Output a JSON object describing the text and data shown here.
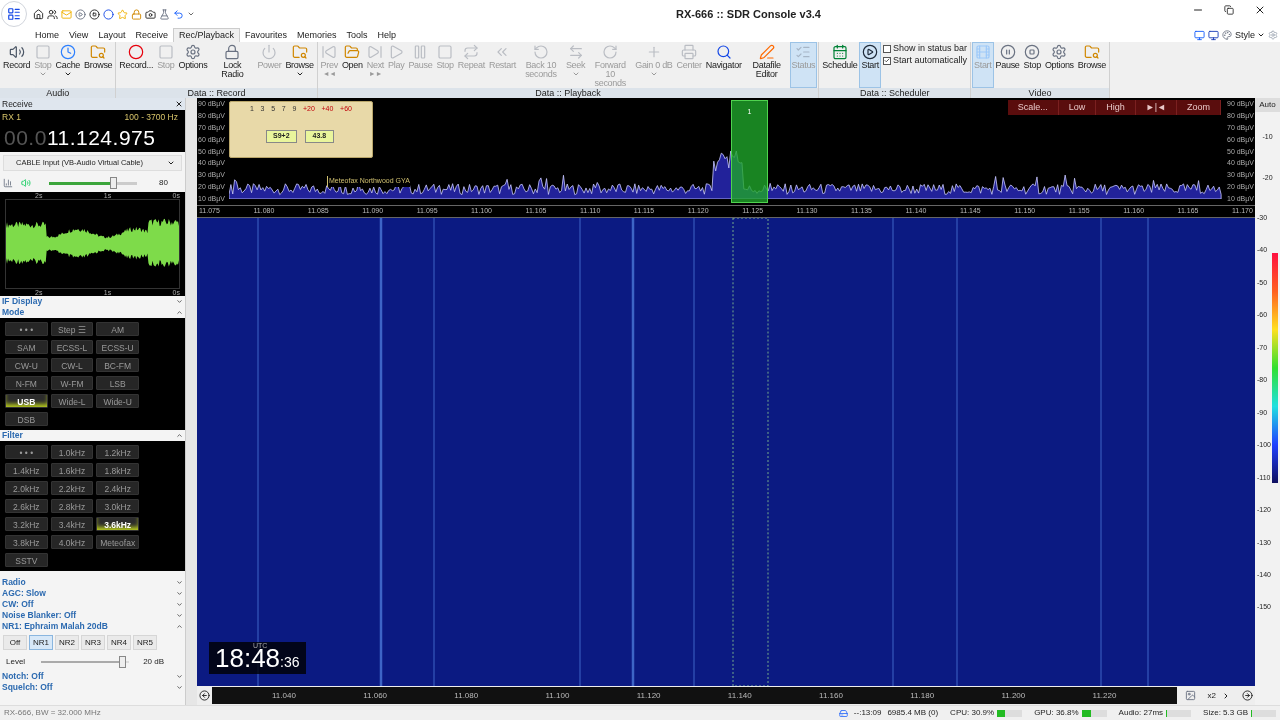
{
  "window": {
    "title": "RX-666 :: SDR Console v3.4",
    "style_menu": "Style"
  },
  "menu_tabs": [
    {
      "label": "Home",
      "selected": false
    },
    {
      "label": "View",
      "selected": false
    },
    {
      "label": "Layout",
      "selected": false
    },
    {
      "label": "Receive",
      "selected": false
    },
    {
      "label": "Rec/Playback",
      "selected": true
    },
    {
      "label": "Favourites",
      "selected": false
    },
    {
      "label": "Memories",
      "selected": false
    },
    {
      "label": "Tools",
      "selected": false
    },
    {
      "label": "Help",
      "selected": false
    }
  ],
  "ribbon": [
    {
      "name": "Audio",
      "buttons": [
        {
          "label": "Record",
          "disabled": false,
          "pressed": false,
          "caret": false
        },
        {
          "label": "Stop",
          "disabled": true,
          "pressed": false,
          "caret": true
        },
        {
          "label": "Cache",
          "disabled": false,
          "pressed": false,
          "caret": true
        },
        {
          "label": "Browse",
          "disabled": false,
          "pressed": false,
          "caret": false
        }
      ]
    },
    {
      "name": "Data :: Record",
      "buttons": [
        {
          "label": "Record...",
          "disabled": false,
          "pressed": false,
          "caret": false
        },
        {
          "label": "Stop",
          "disabled": true,
          "pressed": false,
          "caret": false
        },
        {
          "label": "Options",
          "disabled": false,
          "pressed": false,
          "caret": false
        },
        {
          "label": "Lock Radio",
          "disabled": false,
          "pressed": false,
          "caret": false
        },
        {
          "label": "Power",
          "disabled": true,
          "pressed": false,
          "caret": false
        },
        {
          "label": "Browse",
          "disabled": false,
          "pressed": false,
          "caret": true
        }
      ]
    },
    {
      "name": "Data :: Playback",
      "buttons": [
        {
          "label": "Prev",
          "sub": "◄◄",
          "disabled": true,
          "pressed": false,
          "caret": false
        },
        {
          "label": "Open",
          "disabled": false,
          "pressed": false,
          "caret": false
        },
        {
          "label": "Next",
          "sub": "►►",
          "disabled": true,
          "pressed": false,
          "caret": false
        },
        {
          "label": "Play",
          "disabled": true,
          "pressed": false,
          "caret": false
        },
        {
          "label": "Pause",
          "disabled": true,
          "pressed": false,
          "caret": false
        },
        {
          "label": "Stop",
          "disabled": true,
          "pressed": false,
          "caret": false
        },
        {
          "label": "Repeat",
          "disabled": true,
          "pressed": false,
          "caret": false
        },
        {
          "label": "Restart",
          "disabled": true,
          "pressed": false,
          "caret": false
        },
        {
          "label": "Back 10 seconds",
          "disabled": true,
          "pressed": false,
          "caret": false
        },
        {
          "label": "Seek",
          "disabled": true,
          "pressed": false,
          "caret": true
        },
        {
          "label": "Forward 10 seconds",
          "disabled": true,
          "pressed": false,
          "caret": false
        },
        {
          "label": "Gain 0 dB",
          "disabled": true,
          "pressed": false,
          "caret": true
        },
        {
          "label": "Center",
          "disabled": true,
          "pressed": false,
          "caret": false
        },
        {
          "label": "Navigator",
          "disabled": false,
          "pressed": false,
          "caret": false
        },
        {
          "label": "Datafile Editor",
          "disabled": false,
          "pressed": false,
          "caret": false
        },
        {
          "label": "Status",
          "disabled": true,
          "pressed": true,
          "caret": false
        }
      ]
    },
    {
      "name": "Data :: Scheduler",
      "buttons": [
        {
          "label": "Schedule",
          "disabled": false,
          "pressed": false,
          "caret": false
        },
        {
          "label": "Start",
          "disabled": false,
          "pressed": true,
          "caret": false
        }
      ],
      "checkboxes": [
        {
          "label": "Show in status bar",
          "checked": false
        },
        {
          "label": "Start automatically",
          "checked": true
        }
      ]
    },
    {
      "name": "Video",
      "buttons": [
        {
          "label": "Start",
          "disabled": true,
          "pressed": true,
          "caret": false
        },
        {
          "label": "Pause",
          "disabled": false,
          "pressed": false,
          "caret": false
        },
        {
          "label": "Stop",
          "disabled": false,
          "pressed": false,
          "caret": false
        },
        {
          "label": "Options",
          "disabled": false,
          "pressed": false,
          "caret": false
        },
        {
          "label": "Browse",
          "disabled": false,
          "pressed": false,
          "caret": false
        }
      ]
    }
  ],
  "receive_panel": {
    "title": "Receive",
    "rx": "RX 1",
    "bandwidth": "100 - 3700 Hz",
    "frequency_prefix": "00.0",
    "frequency": "11.124.975",
    "audio_input": "CABLE Input (VB-Audio Virtual Cable)",
    "volume": {
      "level": 0.77,
      "reading": "80"
    },
    "scope_labels_top": [
      "2s",
      "1s",
      "0s"
    ],
    "scope_labels_bottom": [
      "2s",
      "1s",
      "0s"
    ],
    "sections": [
      {
        "label": "IF Display",
        "expanded": false
      },
      {
        "label": "Mode",
        "expanded": true
      }
    ],
    "modes": [
      {
        "label": "• • •",
        "selected": false
      },
      {
        "label": "Step ☰",
        "selected": false
      },
      {
        "label": "AM",
        "selected": false
      },
      {
        "label": "SAM",
        "selected": false
      },
      {
        "label": "ECSS-L",
        "selected": false
      },
      {
        "label": "ECSS-U",
        "selected": false
      },
      {
        "label": "CW-U",
        "selected": false
      },
      {
        "label": "CW-L",
        "selected": false
      },
      {
        "label": "BC-FM",
        "selected": false
      },
      {
        "label": "N-FM",
        "selected": false
      },
      {
        "label": "W-FM",
        "selected": false
      },
      {
        "label": "LSB",
        "selected": false
      },
      {
        "label": "USB",
        "selected": true
      },
      {
        "label": "Wide-L",
        "selected": false
      },
      {
        "label": "Wide-U",
        "selected": false
      },
      {
        "label": "DSB",
        "selected": false
      }
    ],
    "filter_section": {
      "label": "Filter",
      "expanded": true
    },
    "filters": [
      {
        "label": "• • •",
        "selected": false
      },
      {
        "label": "1.0kHz",
        "selected": false
      },
      {
        "label": "1.2kHz",
        "selected": false
      },
      {
        "label": "1.4kHz",
        "selected": false
      },
      {
        "label": "1.6kHz",
        "selected": false
      },
      {
        "label": "1.8kHz",
        "selected": false
      },
      {
        "label": "2.0kHz",
        "selected": false
      },
      {
        "label": "2.2kHz",
        "selected": false
      },
      {
        "label": "2.4kHz",
        "selected": false
      },
      {
        "label": "2.6kHz",
        "selected": false
      },
      {
        "label": "2.8kHz",
        "selected": false
      },
      {
        "label": "3.0kHz",
        "selected": false
      },
      {
        "label": "3.2kHz",
        "selected": false
      },
      {
        "label": "3.4kHz",
        "selected": false
      },
      {
        "label": "3.6kHz",
        "selected": true
      },
      {
        "label": "3.8kHz",
        "selected": false
      },
      {
        "label": "4.0kHz",
        "selected": false
      },
      {
        "label": "Meteofax",
        "selected": false
      },
      {
        "label": "SSTV",
        "selected": false
      }
    ],
    "radio_sections": [
      {
        "label": "Radio",
        "expanded": false
      },
      {
        "label": "AGC: Slow",
        "expanded": false
      },
      {
        "label": "CW: Off",
        "expanded": false
      },
      {
        "label": "Noise Blanker: Off",
        "expanded": false
      },
      {
        "label": "NR1: Ephraim Malah 20dB",
        "expanded": true
      }
    ],
    "nr_buttons": [
      {
        "label": "Off",
        "selected": false
      },
      {
        "label": "NR1",
        "selected": true
      },
      {
        "label": "NR2",
        "selected": false
      },
      {
        "label": "NR3",
        "selected": false
      },
      {
        "label": "NR4",
        "selected": false
      },
      {
        "label": "NR5",
        "selected": false
      }
    ],
    "nr_level": {
      "label": "Level",
      "level": 0.96,
      "reading": "20 dB"
    },
    "more_sections": [
      {
        "label": "Notch: Off",
        "expanded": false
      },
      {
        "label": "Squelch: Off",
        "expanded": false
      }
    ]
  },
  "spectrum": {
    "db_labels_left": [
      "90 dBµV",
      "80 dBµV",
      "70 dBµV",
      "60 dBµV",
      "50 dBµV",
      "40 dBµV",
      "30 dBµV",
      "20 dBµV",
      "10 dBµV"
    ],
    "db_labels_right": [
      "90 dBµV",
      "80 dBµV",
      "70 dBµV",
      "60 dBµV",
      "50 dBµV",
      "40 dBµV",
      "30 dBµV",
      "20 dBµV",
      "10 dBµV"
    ],
    "s_meter": {
      "scale": [
        "1",
        "3",
        "5",
        "7",
        "9",
        "+20",
        "+40",
        "+60"
      ],
      "s_reading": "S9+2",
      "db_reading": "43.8"
    },
    "marker": "Meteofax Northwood GYA",
    "channel": "1",
    "controls": [
      "Scale...",
      "Low",
      "High",
      "►|◄",
      "Zoom"
    ],
    "auto": "Auto",
    "right_labels": [
      "-10",
      "-20"
    ],
    "frequencies": [
      "11.075",
      "11.080",
      "11.085",
      "11.090",
      "11.095",
      "11.100",
      "11.105",
      "11.110",
      "11.115",
      "11.120",
      "11.125",
      "11.130",
      "11.135",
      "11.140",
      "11.145",
      "11.150",
      "11.155",
      "11.160",
      "11.165",
      "11.170"
    ]
  },
  "waterfall": {
    "scale_labels": [
      "-30",
      "-40",
      "-50",
      "-60",
      "-70",
      "-80",
      "-90",
      "-100",
      "-110",
      "-120",
      "-130",
      "-140",
      "-150"
    ],
    "clock": "18:48",
    "seconds": ":36",
    "clock_label": "UTC"
  },
  "overview": {
    "frequencies": [
      "11.040",
      "11.060",
      "11.080",
      "11.100",
      "11.120",
      "11.140",
      "11.160",
      "11.180",
      "11.200",
      "11.220"
    ],
    "zoom": "x2"
  },
  "status_bar": {
    "left": "RX-666, BW = 32.000 MHz",
    "time": "--:13:09",
    "memory": "6985.4 MB (0)",
    "meters": [
      {
        "label": "CPU: 30.9%",
        "level": 0.31
      },
      {
        "label": "GPU: 36.8%",
        "level": 0.37
      },
      {
        "label": "Audio: 27ms",
        "level": 0.04
      },
      {
        "label": "Size: 5.3 GB",
        "level": 0.05
      }
    ]
  }
}
